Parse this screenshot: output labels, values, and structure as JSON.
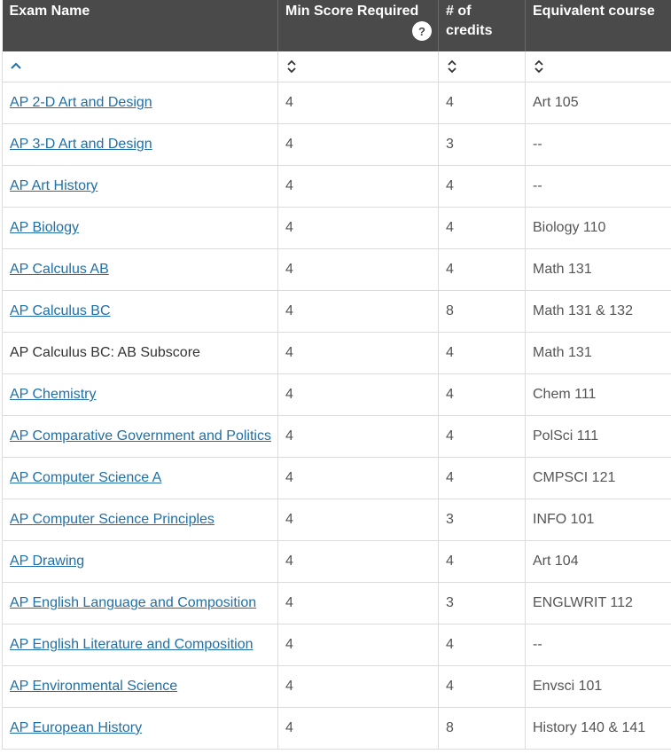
{
  "headers": {
    "exam_name": "Exam Name",
    "min_score": "Min Score Required",
    "help_glyph": "?",
    "credits_line1": "# of",
    "credits_line2": "credits",
    "equivalent": "Equivalent course"
  },
  "sort_icons": {
    "exam_name": "sort-ascending-icon",
    "min_score": "sort-both-icon",
    "credits": "sort-both-icon",
    "equivalent": "sort-both-icon"
  },
  "colors": {
    "header_bg": "#4a4a4a",
    "link": "#1f6fa8",
    "border": "#dcdcdc"
  },
  "rows": [
    {
      "exam": "AP 2-D Art and Design",
      "link": true,
      "score": "4",
      "credits": "4",
      "course": "Art 105"
    },
    {
      "exam": "AP 3-D Art and Design",
      "link": true,
      "score": "4",
      "credits": "3",
      "course": "--"
    },
    {
      "exam": "AP Art History",
      "link": true,
      "score": "4",
      "credits": "4",
      "course": "--"
    },
    {
      "exam": "AP Biology",
      "link": true,
      "score": "4",
      "credits": "4",
      "course": "Biology 110"
    },
    {
      "exam": "AP Calculus AB",
      "link": true,
      "score": "4",
      "credits": "4",
      "course": "Math 131"
    },
    {
      "exam": "AP Calculus BC",
      "link": true,
      "score": "4",
      "credits": "8",
      "course": "Math 131 & 132"
    },
    {
      "exam": "AP Calculus BC: AB Subscore",
      "link": false,
      "score": "4",
      "credits": "4",
      "course": "Math 131"
    },
    {
      "exam": "AP Chemistry",
      "link": true,
      "score": "4",
      "credits": "4",
      "course": "Chem 111"
    },
    {
      "exam": "AP Comparative Government and Politics",
      "link": true,
      "score": "4",
      "credits": "4",
      "course": "PolSci 111"
    },
    {
      "exam": "AP Computer Science A",
      "link": true,
      "score": "4",
      "credits": "4",
      "course": "CMPSCI 121"
    },
    {
      "exam": "AP Computer Science Principles",
      "link": true,
      "score": "4",
      "credits": "3",
      "course": "INFO 101"
    },
    {
      "exam": "AP Drawing",
      "link": true,
      "score": "4",
      "credits": "4",
      "course": "Art 104"
    },
    {
      "exam": "AP English Language and Composition",
      "link": true,
      "score": "4",
      "credits": "3",
      "course": "ENGLWRIT 112"
    },
    {
      "exam": "AP English Literature and Composition",
      "link": true,
      "score": "4",
      "credits": "4",
      "course": "--"
    },
    {
      "exam": "AP Environmental Science",
      "link": true,
      "score": "4",
      "credits": "4",
      "course": "Envsci 101"
    },
    {
      "exam": "AP European History",
      "link": true,
      "score": "4",
      "credits": "8",
      "course": "History 140 & 141"
    }
  ]
}
